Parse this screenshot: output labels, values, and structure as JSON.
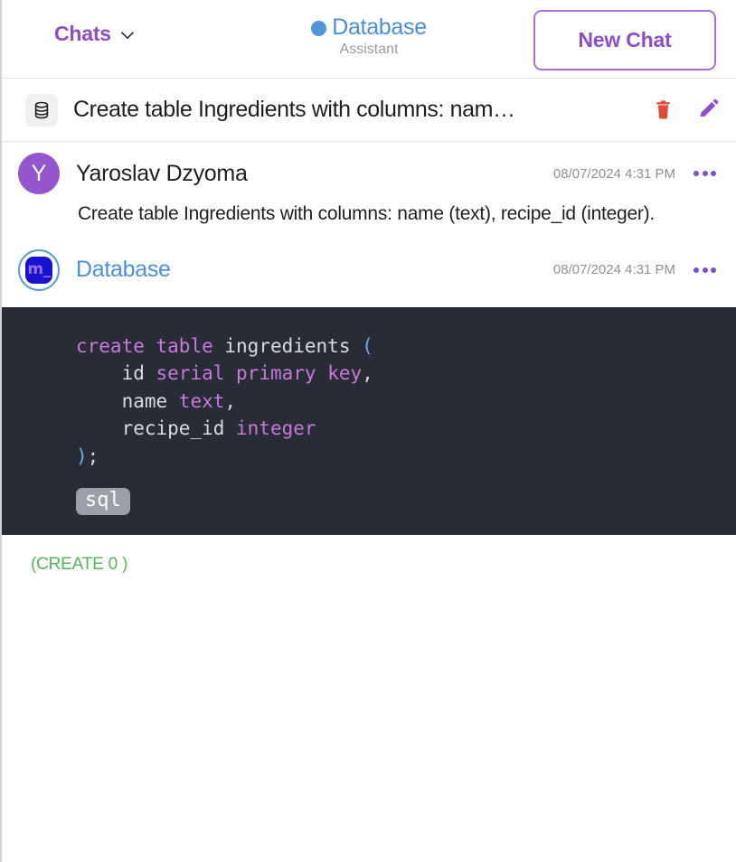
{
  "header": {
    "chats_label": "Chats",
    "chats_caret_icon": "chevron-down-icon",
    "assistant_name": "Database",
    "assistant_subtitle": "Assistant",
    "status_dot_icon": "status-dot-online",
    "status_dot_color": "#4f95da",
    "new_chat_label": "New Chat",
    "accent_color": "#8e4ec6",
    "assistant_name_color": "#4a90d9"
  },
  "chat_titlebar": {
    "icon": "database-icon",
    "title": "Create table Ingredients with columns: nam…",
    "delete_icon": "trash-icon",
    "delete_color": "#e14a36",
    "edit_icon": "pencil-icon",
    "edit_color": "#8e4ec6"
  },
  "messages": [
    {
      "role": "user",
      "avatar_initial": "Y",
      "avatar_color": "#9455cd",
      "name": "Yaroslav Dzyoma",
      "timestamp": "08/07/2024 4:31 PM",
      "menu_icon": "more-options-icon",
      "text": "Create table Ingredients with columns: name (text), recipe_id (integer)."
    },
    {
      "role": "assistant",
      "avatar_logo_text": "m_",
      "avatar_logo_bg": "#1712cf",
      "avatar_logo_fg": "#9b6ef3",
      "name": "Database",
      "timestamp": "08/07/2024 4:31 PM",
      "menu_icon": "more-options-icon",
      "code": {
        "language_badge": "sql",
        "lines": [
          [
            {
              "t": "create",
              "c": "kw"
            },
            {
              "t": " ",
              "c": "id"
            },
            {
              "t": "table",
              "c": "kw"
            },
            {
              "t": " ",
              "c": "id"
            },
            {
              "t": "ingredients",
              "c": "id"
            },
            {
              "t": " ",
              "c": "id"
            },
            {
              "t": "(",
              "c": "pn"
            }
          ],
          [
            {
              "t": "    id ",
              "c": "id"
            },
            {
              "t": "serial",
              "c": "kw"
            },
            {
              "t": " ",
              "c": "id"
            },
            {
              "t": "primary",
              "c": "kw"
            },
            {
              "t": " ",
              "c": "id"
            },
            {
              "t": "key",
              "c": "kw"
            },
            {
              "t": ",",
              "c": "id"
            }
          ],
          [
            {
              "t": "    name ",
              "c": "id"
            },
            {
              "t": "text",
              "c": "kw"
            },
            {
              "t": ",",
              "c": "id"
            }
          ],
          [
            {
              "t": "    recipe_id ",
              "c": "id"
            },
            {
              "t": "integer",
              "c": "kw"
            }
          ],
          [
            {
              "t": ")",
              "c": "pn"
            },
            {
              "t": ";",
              "c": "id"
            }
          ]
        ],
        "raw": "create table ingredients (\n    id serial primary key,\n    name text,\n    recipe_id integer\n);"
      },
      "result_text": "(CREATE 0 )",
      "result_color": "#55b65a"
    }
  ]
}
